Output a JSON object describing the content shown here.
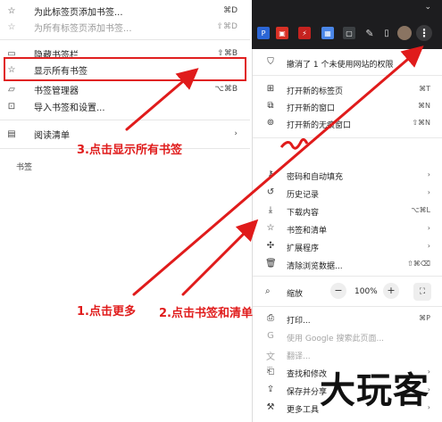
{
  "bookmarks_submenu": {
    "items": [
      {
        "label": "为此标签页添加书签...",
        "shortcut": "⌘D",
        "icon": "star-icon"
      },
      {
        "label": "为所有标签页添加书签...",
        "shortcut": "⇧⌘D",
        "icon": "star-icon"
      },
      {
        "label": "隐藏书签栏",
        "shortcut": "⇧⌘B",
        "icon": "bookmark-bar-icon"
      },
      {
        "label": "显示所有书签",
        "shortcut": "",
        "icon": "star-icon"
      },
      {
        "label": "书签管理器",
        "shortcut": "⌥⌘B",
        "icon": "folder-icon"
      },
      {
        "label": "导入书签和设置...",
        "shortcut": "",
        "icon": "import-icon"
      },
      {
        "label": "阅读清单",
        "shortcut": "",
        "icon": "reading-list-icon"
      }
    ],
    "section_label": "书签"
  },
  "chrome_menu": {
    "notice": "撤消了 1 个未使用网站的权限",
    "items": [
      {
        "label": "打开新的标签页",
        "shortcut": "⌘T",
        "icon": "new-tab-icon"
      },
      {
        "label": "打开新的窗口",
        "shortcut": "⌘N",
        "icon": "new-window-icon"
      },
      {
        "label": "打开新的无痕窗口",
        "shortcut": "⇧⌘N",
        "icon": "incognito-icon"
      },
      {
        "label": "密码和自动填充",
        "shortcut": "",
        "icon": "key-icon"
      },
      {
        "label": "历史记录",
        "shortcut": "",
        "icon": "history-icon"
      },
      {
        "label": "下载内容",
        "shortcut": "⌥⌘L",
        "icon": "download-icon"
      },
      {
        "label": "书签和清单",
        "shortcut": "",
        "icon": "star-icon"
      },
      {
        "label": "扩展程序",
        "shortcut": "",
        "icon": "extension-icon"
      },
      {
        "label": "清除浏览数据...",
        "shortcut": "⇧⌘⌫",
        "icon": "trash-icon"
      },
      {
        "label": "打印...",
        "shortcut": "⌘P",
        "icon": "print-icon"
      },
      {
        "label": "使用 Google 搜索此页面...",
        "shortcut": "",
        "icon": "google-icon"
      },
      {
        "label": "翻译...",
        "shortcut": "",
        "icon": "translate-icon"
      },
      {
        "label": "查找和修改",
        "shortcut": "",
        "icon": "find-icon"
      },
      {
        "label": "保存并分享",
        "shortcut": "",
        "icon": "share-icon"
      },
      {
        "label": "更多工具",
        "shortcut": "",
        "icon": "tools-icon"
      }
    ],
    "zoom": {
      "label": "缩放",
      "minus": "−",
      "value": "100%",
      "plus": "+"
    }
  },
  "annotations": {
    "step1": "1.点击更多",
    "step2": "2.点击书签和清单",
    "step3": "3.点击显示所有书签"
  },
  "watermark": "大玩客",
  "colors": {
    "annotation": "#e01b1b",
    "toolbar": "#1d1d1f"
  }
}
